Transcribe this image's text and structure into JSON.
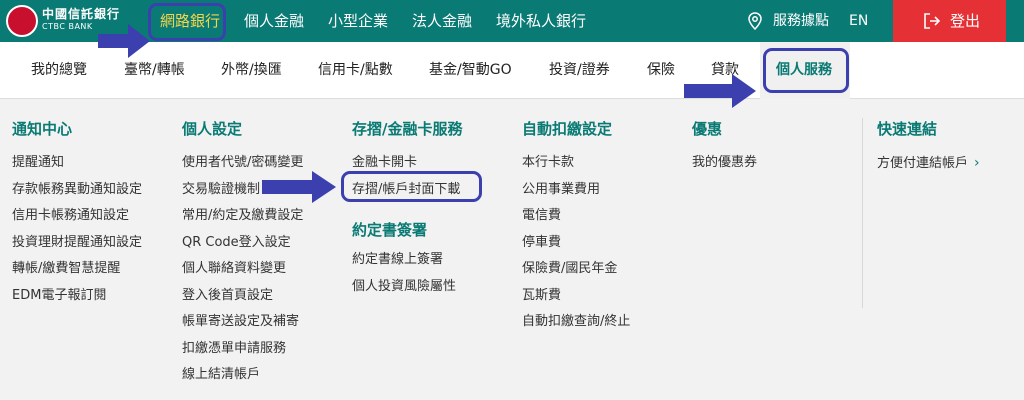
{
  "brand": {
    "name_cn": "中國信託銀行",
    "name_en": "CTBC BANK"
  },
  "topnav": {
    "items": [
      {
        "label": "網路銀行"
      },
      {
        "label": "個人金融"
      },
      {
        "label": "小型企業"
      },
      {
        "label": "法人金融"
      },
      {
        "label": "境外私人銀行"
      }
    ],
    "service_label": "服務據點",
    "lang_label": "EN",
    "logout_label": "登出"
  },
  "subnav": {
    "items": [
      {
        "label": "我的總覽"
      },
      {
        "label": "臺幣/轉帳"
      },
      {
        "label": "外幣/換匯"
      },
      {
        "label": "信用卡/點數"
      },
      {
        "label": "基金/智動GO"
      },
      {
        "label": "投資/證券"
      },
      {
        "label": "保險"
      },
      {
        "label": "貸款"
      },
      {
        "label": "個人服務"
      }
    ]
  },
  "menu": {
    "notify": {
      "title": "通知中心",
      "items": [
        "提醒通知",
        "存款帳務異動通知設定",
        "信用卡帳務通知設定",
        "投資理財提醒通知設定",
        "轉帳/繳費智慧提醒",
        "EDM電子報訂閱"
      ]
    },
    "personal": {
      "title": "個人設定",
      "items": [
        "使用者代號/密碼變更",
        "交易驗證機制",
        "常用/約定及繳費設定",
        "QR Code登入設定",
        "個人聯絡資料變更",
        "登入後首頁設定",
        "帳單寄送設定及補寄",
        "扣繳憑單申請服務",
        "線上結清帳戶"
      ]
    },
    "card": {
      "title": "存摺/金融卡服務",
      "items": [
        "金融卡開卡",
        "存摺/帳戶封面下載"
      ],
      "title2": "約定書簽署",
      "items2": [
        "約定書線上簽署",
        "個人投資風險屬性"
      ]
    },
    "autopay": {
      "title": "自動扣繳設定",
      "items": [
        "本行卡款",
        "公用事業費用",
        "電信費",
        "停車費",
        "保險費/國民年金",
        "瓦斯費",
        "自動扣繳查詢/終止"
      ]
    },
    "offers": {
      "title": "優惠",
      "items": [
        "我的優惠券"
      ]
    },
    "quick": {
      "title": "快速連結",
      "items": [
        "方便付連結帳戶"
      ]
    }
  },
  "colors": {
    "brand_green": "#0a7a74",
    "active_yellow": "#f2d64b",
    "logout_red": "#e53035",
    "annotation_blue": "#3c3fae"
  }
}
